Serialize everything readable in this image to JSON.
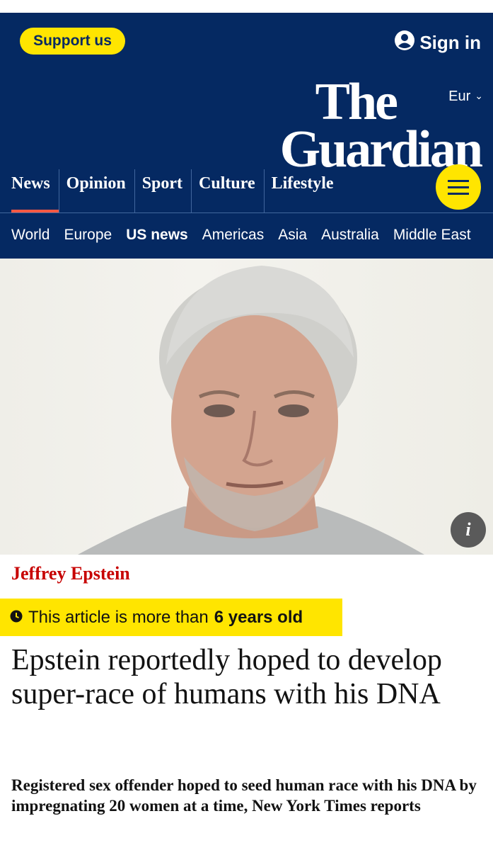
{
  "header": {
    "support_label": "Support us",
    "signin_label": "Sign in",
    "edition_label": "Eur",
    "logo_line1": "The",
    "logo_line2": "Guardian"
  },
  "nav": {
    "pillars": [
      {
        "label": "News",
        "active": true
      },
      {
        "label": "Opinion"
      },
      {
        "label": "Sport"
      },
      {
        "label": "Culture"
      },
      {
        "label": "Lifestyle"
      }
    ],
    "subnav": [
      "World",
      "Europe",
      "US news",
      "Americas",
      "Asia",
      "Australia",
      "Middle East"
    ]
  },
  "article": {
    "kicker": "Jeffrey Epstein",
    "age_prefix": "This article is more than",
    "age_value": "6 years old",
    "headline": "Epstein reportedly hoped to develop super-race of humans with his DNA",
    "standfirst": "Registered sex offender hoped to seed human race with his DNA by impregnating 20 women at a time, New York Times reports"
  },
  "icons": {
    "account": "account-icon",
    "menu": "hamburger-menu-icon",
    "info": "info-icon",
    "clock": "clock-icon"
  },
  "colors": {
    "brand_blue": "#052962",
    "yellow": "#ffe500",
    "news_red": "#c70000",
    "active_underline": "#ff5943"
  }
}
